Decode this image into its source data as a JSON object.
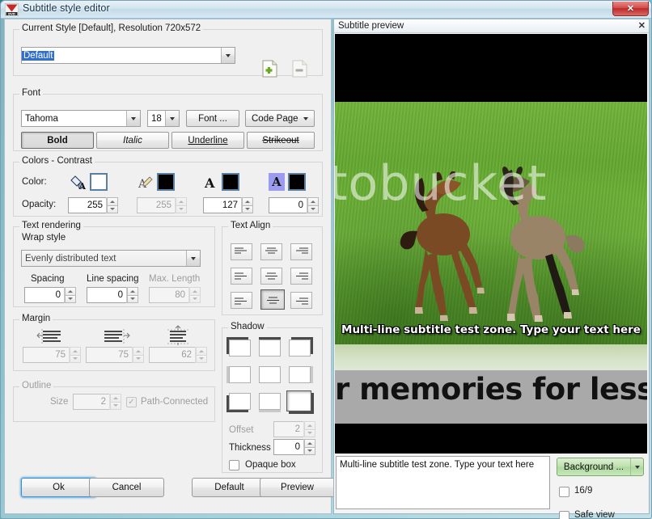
{
  "window": {
    "title": "Subtitle style editor",
    "icon": "dvd-icon",
    "close_label": "✕"
  },
  "style_group": {
    "legend": "Current Style [Default], Resolution 720x572",
    "selected_style": "Default",
    "add_button": "new-style-icon",
    "remove_button": "delete-style-icon"
  },
  "font_group": {
    "legend": "Font",
    "family": "Tahoma",
    "size": "18",
    "font_button": "Font ...",
    "code_page_button": "Code Page",
    "bold": "Bold",
    "italic": "Italic",
    "underline": "Underline",
    "strikeout": "Strikeout"
  },
  "colors_group": {
    "legend": "Colors - Contrast",
    "color_label": "Color:",
    "opacity_label": "Opacity:",
    "items": [
      {
        "icon": "fill-color-icon",
        "swatch": "#ffffff",
        "opacity": "255",
        "disabled": false
      },
      {
        "icon": "outline-color-icon",
        "swatch": "#000000",
        "opacity": "255",
        "disabled": true
      },
      {
        "icon": "text-color-icon",
        "swatch": "#000000",
        "opacity": "127",
        "disabled": false
      },
      {
        "icon": "highlight-color-icon",
        "swatch": "#000000",
        "opacity": "0",
        "disabled": false
      }
    ]
  },
  "text_rendering_group": {
    "legend": "Text rendering",
    "wrap_label": "Wrap style",
    "wrap_value": "Evenly distributed text",
    "spacing_label": "Spacing",
    "spacing_value": "0",
    "line_spacing_label": "Line spacing",
    "line_spacing_value": "0",
    "max_length_label": "Max. Length",
    "max_length_value": "80"
  },
  "margin_group": {
    "legend": "Margin",
    "left_icon": "margin-left-icon",
    "right_icon": "margin-right-icon",
    "vertical_icon": "margin-vertical-icon",
    "left_value": "75",
    "right_value": "75",
    "vertical_value": "62"
  },
  "outline_group": {
    "legend": "Outline",
    "size_label": "Size",
    "size_value": "2",
    "path_connected_label": "Path-Connected",
    "path_connected_checked": true
  },
  "text_align_group": {
    "legend": "Text Align",
    "cells": [
      {
        "name": "align-top-left",
        "selected": false
      },
      {
        "name": "align-top-center",
        "selected": false
      },
      {
        "name": "align-top-right",
        "selected": false
      },
      {
        "name": "align-middle-left",
        "selected": false
      },
      {
        "name": "align-middle-center",
        "selected": false
      },
      {
        "name": "align-middle-right",
        "selected": false
      },
      {
        "name": "align-bottom-left",
        "selected": false
      },
      {
        "name": "align-bottom-center",
        "selected": true
      },
      {
        "name": "align-bottom-right",
        "selected": false
      }
    ]
  },
  "shadow_group": {
    "legend": "Shadow",
    "cells": [
      {
        "name": "shadow-top-left",
        "selected": false
      },
      {
        "name": "shadow-top-center",
        "selected": false
      },
      {
        "name": "shadow-top-right",
        "selected": false
      },
      {
        "name": "shadow-middle-left",
        "selected": false
      },
      {
        "name": "shadow-none",
        "selected": false
      },
      {
        "name": "shadow-middle-right",
        "selected": false
      },
      {
        "name": "shadow-bottom-left",
        "selected": false
      },
      {
        "name": "shadow-bottom-center",
        "selected": false
      },
      {
        "name": "shadow-bottom-right",
        "selected": true
      }
    ],
    "offset_label": "Offset",
    "offset_value": "2",
    "thickness_label": "Thickness",
    "thickness_value": "0",
    "opaque_box_label": "Opaque box",
    "opaque_box_checked": false
  },
  "buttons": {
    "ok": "Ok",
    "cancel": "Cancel",
    "default": "Default",
    "preview": "Preview"
  },
  "preview": {
    "title": "Subtitle preview",
    "close_label": "✕",
    "subtitle_overlay": "Multi-line subtitle test zone. Type your text here",
    "banner_text": "r memories for less!",
    "watermark": "tobucket",
    "watermark2": "photobucket",
    "subtitle_edit_text": "Multi-line subtitle test zone. Type your text here",
    "background_button": "Background ...",
    "aspect_label": "16/9",
    "aspect_checked": false,
    "safe_view_label": "Safe view",
    "safe_view_checked": false
  }
}
